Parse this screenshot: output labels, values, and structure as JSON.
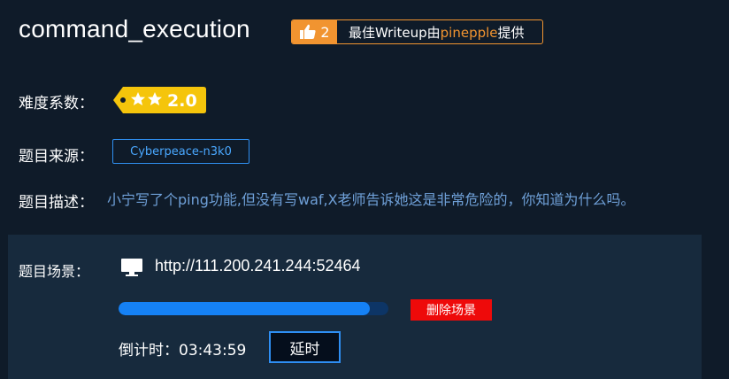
{
  "challenge": {
    "title": "command_execution"
  },
  "writeup": {
    "count": "2",
    "text_prefix": "最佳Writeup由",
    "author": "pinepple",
    "text_suffix": "提供"
  },
  "difficulty": {
    "label": "难度系数：",
    "value": "2.0",
    "stars": 2
  },
  "source": {
    "label": "题目来源：",
    "value": "Cyberpeace-n3k0"
  },
  "description": {
    "label": "题目描述：",
    "text": "小宁写了个ping功能,但没有写waf,X老师告诉她这是非常危险的，你知道为什么吗。"
  },
  "scene": {
    "label": "题目场景：",
    "url": "http://111.200.241.244:52464",
    "progress_fraction": 0.93,
    "delete_label": "删除场景",
    "countdown_label": "倒计时：",
    "countdown_value": "03:43:59",
    "extend_label": "延时"
  },
  "colors": {
    "background": "#0f1b29",
    "panel": "#172a3d",
    "accent_orange": "#f19430",
    "accent_blue": "#2f8ff0",
    "danger": "#ee0a0a",
    "badge_yellow": "#f5c50b",
    "description_text": "#6fa0d8"
  },
  "icons": {
    "thumbs_up": "thumbs-up-icon",
    "monitor": "monitor-icon",
    "star": "star-icon"
  }
}
